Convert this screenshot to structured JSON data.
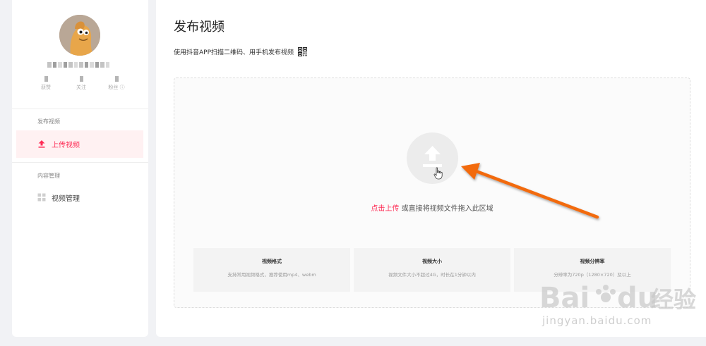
{
  "sidebar": {
    "stats": [
      {
        "label": "获赞"
      },
      {
        "label": "关注"
      },
      {
        "label": "粉丝 ⓘ"
      }
    ],
    "sections": [
      {
        "title": "发布视频",
        "items": [
          {
            "label": "上传视频",
            "icon": "upload-icon",
            "active": true
          }
        ]
      },
      {
        "title": "内容管理",
        "items": [
          {
            "label": "视频管理",
            "icon": "grid-icon",
            "active": false
          }
        ]
      }
    ]
  },
  "main": {
    "title": "发布视频",
    "scan_text": "使用抖音APP扫描二维码、用手机发布视频",
    "scan_icon": "qr-code-icon",
    "upload": {
      "icon": "upload-arrow-icon",
      "click_text": "点击上传",
      "hint_text": " 或直接将视频文件拖入此区域"
    },
    "cards": [
      {
        "title": "视频格式",
        "desc": "支持常用视频格式，推荐使用mp4、webm"
      },
      {
        "title": "视频大小",
        "desc": "视频文件大小不超过4G，时长在1分钟以内"
      },
      {
        "title": "视频分辨率",
        "desc": "分辨率为720p（1280×720）及以上"
      }
    ]
  },
  "watermark": {
    "brand": "Bai",
    "brand_suffix": "du",
    "brand_cn": "经验",
    "domain": "jingyan.baidu.com"
  },
  "colors": {
    "accent": "#fe2c55",
    "annotation_arrow": "#f26a0f"
  }
}
